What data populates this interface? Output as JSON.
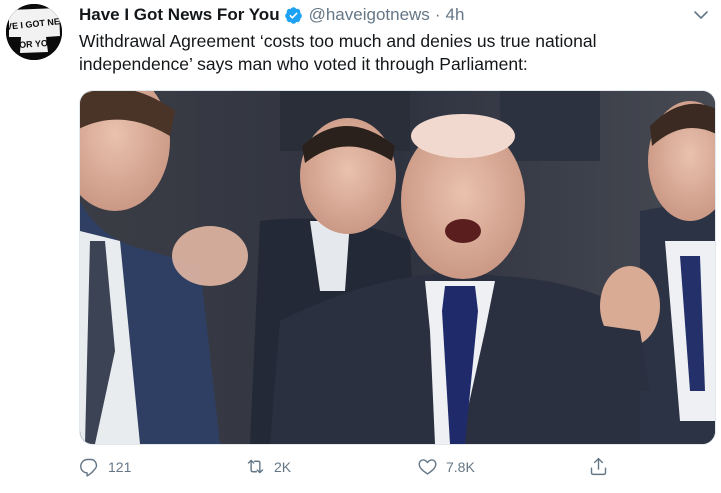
{
  "tweet": {
    "author_name": "Have I Got News For You",
    "handle": "@haveigotnews",
    "separator": "·",
    "time": "4h",
    "verified": true,
    "text": "Withdrawal Agreement ‘costs too much and denies us true national independence’ says man who voted it through Parliament:",
    "avatar_text": [
      "HAVE I GOT NEWS",
      "FOR YOU"
    ],
    "media_description": "photo of cheering MPs in the House of Commons",
    "actions": {
      "reply_count": "121",
      "retweet_count": "2K",
      "like_count": "7.8K"
    }
  },
  "colors": {
    "verified_blue": "#1da1f2",
    "text": "#14171a",
    "secondary": "#657786"
  },
  "icons": {
    "reply": "speech-bubble-icon",
    "retweet": "retweet-arrows-icon",
    "like": "heart-icon",
    "share": "share-upload-icon",
    "menu": "chevron-down-icon"
  }
}
